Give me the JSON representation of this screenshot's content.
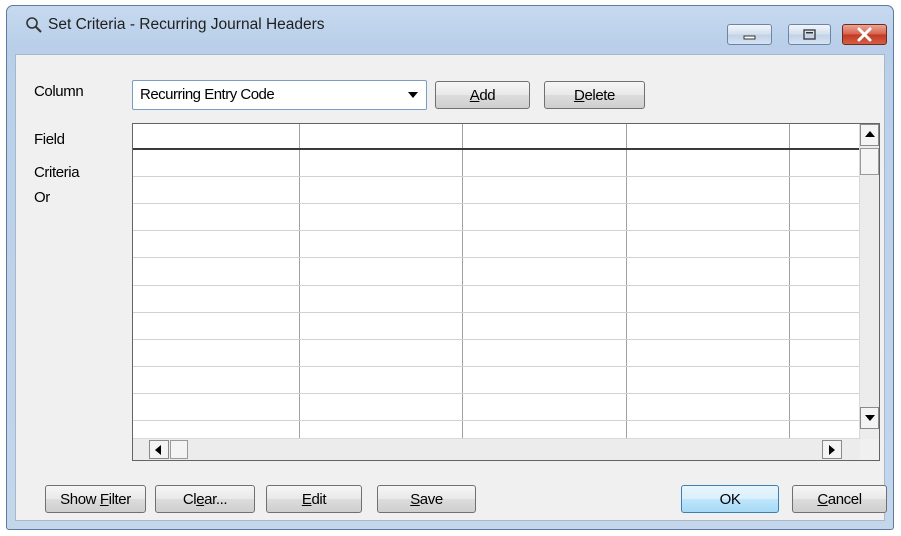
{
  "window": {
    "title": "Set Criteria - Recurring Journal Headers"
  },
  "column_label": "Column",
  "column_select": {
    "value": "Recurring Entry Code"
  },
  "buttons": {
    "add": {
      "pre": "",
      "key": "A",
      "post": "dd"
    },
    "delete": {
      "pre": "",
      "key": "D",
      "post": "elete"
    },
    "show_filter": {
      "pre": "Show ",
      "key": "F",
      "post": "ilter"
    },
    "clear": {
      "pre": "Cl",
      "key": "e",
      "post": "ar..."
    },
    "edit": {
      "pre": "",
      "key": "E",
      "post": "dit"
    },
    "save": {
      "pre": "",
      "key": "S",
      "post": "ave"
    },
    "ok": {
      "label": "OK"
    },
    "cancel": {
      "pre": "",
      "key": "C",
      "post": "ancel"
    }
  },
  "row_labels": [
    "Field",
    "Criteria",
    "Or"
  ]
}
